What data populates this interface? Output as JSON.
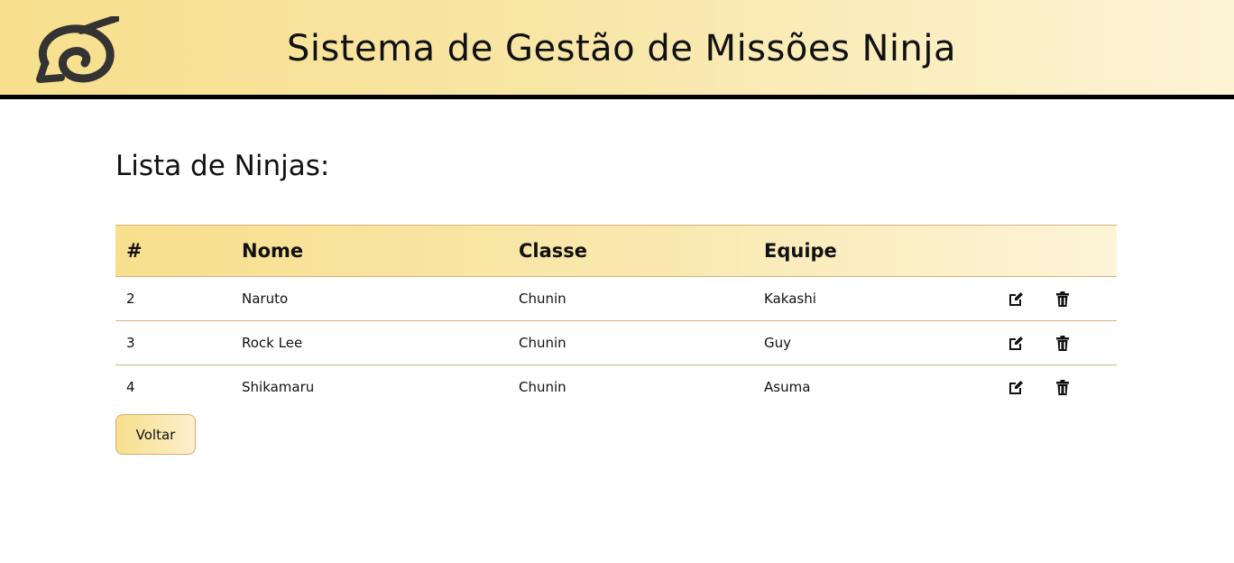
{
  "header": {
    "title": "Sistema de Gestão de Missões Ninja",
    "logo_icon": "konoha-leaf-icon"
  },
  "main": {
    "page_title": "Lista de Ninjas:",
    "table": {
      "columns": [
        "#",
        "Nome",
        "Classe",
        "Equipe"
      ],
      "rows": [
        {
          "id": "2",
          "nome": "Naruto",
          "classe": "Chunin",
          "equipe": "Kakashi"
        },
        {
          "id": "3",
          "nome": "Rock Lee",
          "classe": "Chunin",
          "equipe": "Guy"
        },
        {
          "id": "4",
          "nome": "Shikamaru",
          "classe": "Chunin",
          "equipe": "Asuma"
        }
      ],
      "row_actions": [
        "edit-icon",
        "trash-icon"
      ]
    },
    "back_button_label": "Voltar"
  },
  "colors": {
    "header_gradient_start": "#f7df8d",
    "header_gradient_end": "#fdf4d6",
    "border_accent": "#d8b27a",
    "header_bottom_border": "#000000"
  }
}
